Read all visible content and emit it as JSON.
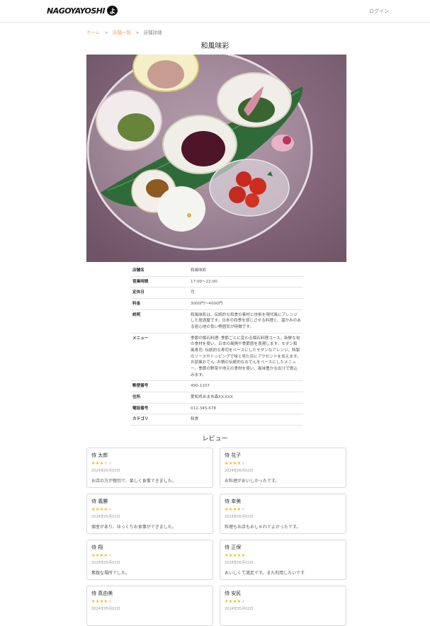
{
  "header": {
    "logo_text": "NAGOYAYOSHI",
    "logo_mark": "よ",
    "login_label": "ログイン"
  },
  "breadcrumb": {
    "home": "ホーム",
    "list": "店舗一覧",
    "current": "店舗詳細",
    "separator": ">"
  },
  "page_title": "和風味彩",
  "info_rows": [
    {
      "key": "店舗名",
      "value": "和風味彩"
    },
    {
      "key": "営業時間",
      "value": "17:00〜22:00"
    },
    {
      "key": "定休日",
      "value": "月"
    },
    {
      "key": "料金",
      "value": "3000円〜4000円"
    },
    {
      "key": "説明",
      "value": "和風味彩は、伝統的な和食の素材と技術を現代風にアレンジした居酒屋です。日本の四季を感じさせる料理と、温かみのある居心地の良い雰囲気が特徴です。"
    },
    {
      "key": "メニュー",
      "value": "季節の懐石料理: 季節ごとに変わる懐石料理コース。新鮮な旬の食材を使い、日本の風情や季節感を表現します。モダン和風寿司: 伝統的な寿司をベースにしたモダンなアレンジ。特製のソースやトッピングで味と見た目にアクセントを加えます。お創風おでん: お鍋の伝統的なおでんをベースにしたメニュー。季節の野菜や地元の食材を使い、風味豊かな出汁で煮込みます。"
    },
    {
      "key": "郵便番号",
      "value": "490-1107"
    },
    {
      "key": "住所",
      "value": "愛知県あま市森XX-XXX"
    },
    {
      "key": "電話番号",
      "value": "012-345-678"
    },
    {
      "key": "カテゴリ",
      "value": "和食"
    }
  ],
  "reviews_title": "レビュー",
  "reviews": [
    {
      "name": "侍 太郎",
      "stars": 3,
      "date": "2024年05月02日",
      "comment": "お店の方が親切で、楽しく食事できました。"
    },
    {
      "name": "侍 花子",
      "stars": 4,
      "date": "2024年05月02日",
      "comment": "お料理がおいしかったです。"
    },
    {
      "name": "侍 義勝",
      "stars": 4,
      "date": "2024年05月02日",
      "comment": "個室があり、ゆっくりお食事ができました。"
    },
    {
      "name": "侍 幸美",
      "stars": 4,
      "date": "2024年05月02日",
      "comment": "料理もお店もおしゃれでよかったです。"
    },
    {
      "name": "侍 翔",
      "stars": 4,
      "date": "2024年05月02日",
      "comment": "素敵な場所でした。"
    },
    {
      "name": "侍 正保",
      "stars": 5,
      "date": "2024年05月02日",
      "comment": "おいしくて満足です。また利用したいです"
    },
    {
      "name": "侍 真由美",
      "stars": 4,
      "date": "2024年05月02日",
      "comment": ""
    },
    {
      "name": "侍 安民",
      "stars": 4,
      "date": "2024年05月02日",
      "comment": ""
    }
  ],
  "colors": {
    "accent": "#e8a35a",
    "star": "#f0b400",
    "hero_bg": "#86677c"
  }
}
